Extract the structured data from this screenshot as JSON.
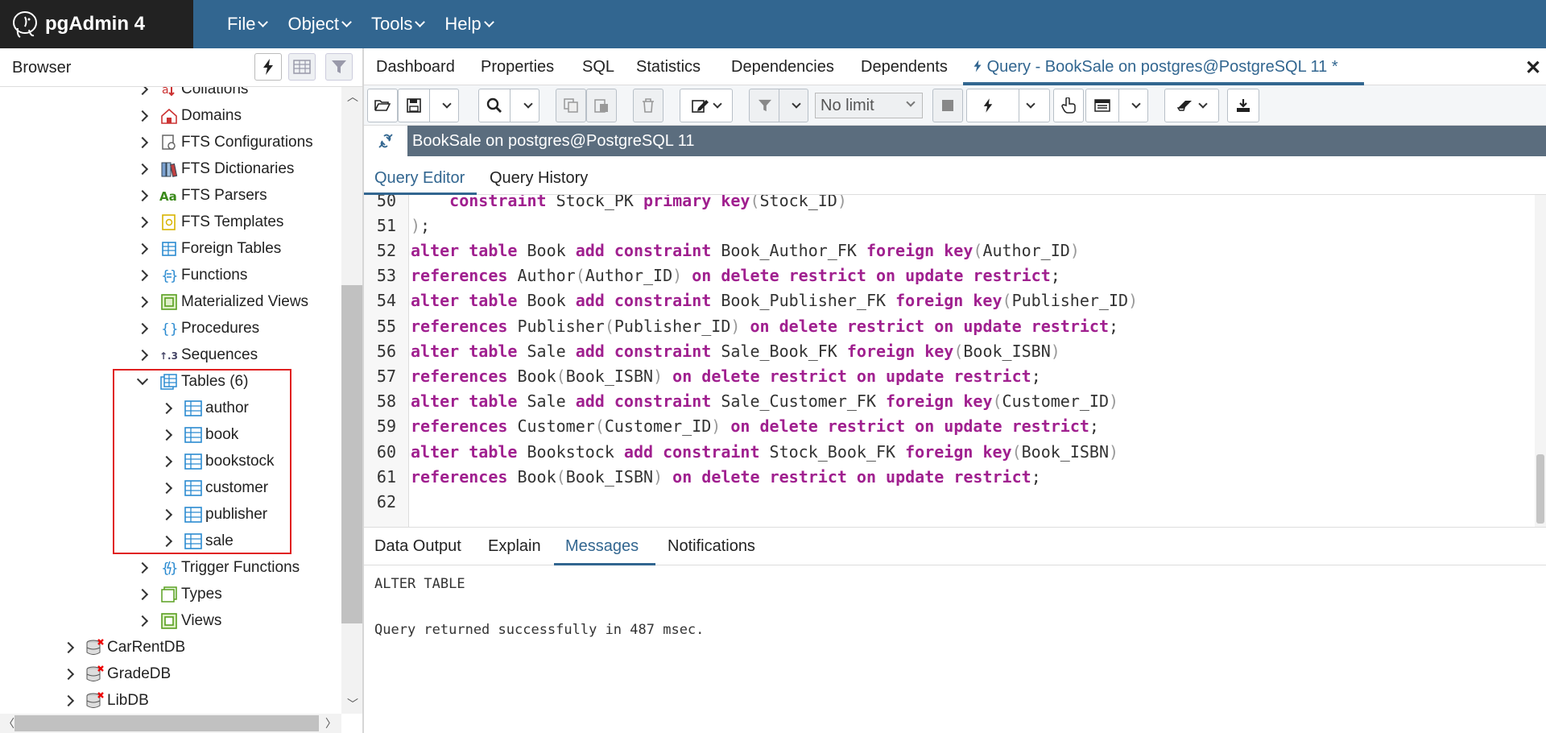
{
  "app": {
    "name": "pgAdmin 4",
    "menu": [
      "File",
      "Object",
      "Tools",
      "Help"
    ]
  },
  "browser": {
    "title": "Browser",
    "tree": [
      {
        "label": "Collations",
        "icon": "collation-icon",
        "level": 2,
        "expanded": false
      },
      {
        "label": "Domains",
        "icon": "domain-icon",
        "level": 2,
        "expanded": false
      },
      {
        "label": "FTS Configurations",
        "icon": "fts-configuration-icon",
        "level": 2,
        "expanded": false
      },
      {
        "label": "FTS Dictionaries",
        "icon": "fts-dictionary-icon",
        "level": 2,
        "expanded": false
      },
      {
        "label": "FTS Parsers",
        "icon": "fts-parser-icon",
        "level": 2,
        "expanded": false
      },
      {
        "label": "FTS Templates",
        "icon": "fts-template-icon",
        "level": 2,
        "expanded": false
      },
      {
        "label": "Foreign Tables",
        "icon": "foreign-table-icon",
        "level": 2,
        "expanded": false
      },
      {
        "label": "Functions",
        "icon": "function-icon",
        "level": 2,
        "expanded": false
      },
      {
        "label": "Materialized Views",
        "icon": "materialized-view-icon",
        "level": 2,
        "expanded": false
      },
      {
        "label": "Procedures",
        "icon": "procedure-icon",
        "level": 2,
        "expanded": false
      },
      {
        "label": "Sequences",
        "icon": "sequence-icon",
        "level": 2,
        "expanded": false
      },
      {
        "label": "Tables (6)",
        "icon": "tables-icon",
        "level": 2,
        "expanded": true
      },
      {
        "label": "author",
        "icon": "table-icon",
        "level": 3,
        "expanded": false
      },
      {
        "label": "book",
        "icon": "table-icon",
        "level": 3,
        "expanded": false
      },
      {
        "label": "bookstock",
        "icon": "table-icon",
        "level": 3,
        "expanded": false
      },
      {
        "label": "customer",
        "icon": "table-icon",
        "level": 3,
        "expanded": false
      },
      {
        "label": "publisher",
        "icon": "table-icon",
        "level": 3,
        "expanded": false
      },
      {
        "label": "sale",
        "icon": "table-icon",
        "level": 3,
        "expanded": false
      },
      {
        "label": "Trigger Functions",
        "icon": "trigger-function-icon",
        "level": 2,
        "expanded": false
      },
      {
        "label": "Types",
        "icon": "type-icon",
        "level": 2,
        "expanded": false
      },
      {
        "label": "Views",
        "icon": "view-icon",
        "level": 2,
        "expanded": false
      },
      {
        "label": "CarRentDB",
        "icon": "database-disconnected-icon",
        "level": 1,
        "expanded": false
      },
      {
        "label": "GradeDB",
        "icon": "database-disconnected-icon",
        "level": 1,
        "expanded": false
      },
      {
        "label": "LibDB",
        "icon": "database-disconnected-icon",
        "level": 1,
        "expanded": false
      }
    ]
  },
  "tabs": [
    "Dashboard",
    "Properties",
    "SQL",
    "Statistics",
    "Dependencies",
    "Dependents",
    "Query - BookSale on postgres@PostgreSQL 11 *"
  ],
  "active_tab": "Query - BookSale on postgres@PostgreSQL 11 *",
  "toolbar": {
    "limit": "No limit"
  },
  "connection": {
    "label": "BookSale on postgres@PostgreSQL 11"
  },
  "editor_tabs": [
    "Query Editor",
    "Query History"
  ],
  "code_lines": [
    {
      "n": "50",
      "tokens": [
        [
          "c",
          "    "
        ],
        [
          "k",
          "constraint"
        ],
        [
          "c",
          " Stock_PK "
        ],
        [
          "k",
          "primary key"
        ],
        [
          "p",
          "("
        ],
        [
          "c",
          "Stock_ID"
        ],
        [
          "p",
          ")"
        ]
      ]
    },
    {
      "n": "51",
      "tokens": [
        [
          "p",
          ")"
        ],
        [
          "c",
          ";"
        ]
      ]
    },
    {
      "n": "52",
      "tokens": [
        [
          "k",
          "alter table"
        ],
        [
          "c",
          " Book "
        ],
        [
          "k",
          "add constraint"
        ],
        [
          "c",
          " Book_Author_FK "
        ],
        [
          "k",
          "foreign key"
        ],
        [
          "p",
          "("
        ],
        [
          "c",
          "Author_ID"
        ],
        [
          "p",
          ")"
        ]
      ]
    },
    {
      "n": "53",
      "tokens": [
        [
          "k",
          "references"
        ],
        [
          "c",
          " Author"
        ],
        [
          "p",
          "("
        ],
        [
          "c",
          "Author_ID"
        ],
        [
          "p",
          ")"
        ],
        [
          "c",
          " "
        ],
        [
          "k",
          "on delete restrict on update restrict"
        ],
        [
          "c",
          ";"
        ]
      ]
    },
    {
      "n": "54",
      "tokens": [
        [
          "k",
          "alter table"
        ],
        [
          "c",
          " Book "
        ],
        [
          "k",
          "add constraint"
        ],
        [
          "c",
          " Book_Publisher_FK "
        ],
        [
          "k",
          "foreign key"
        ],
        [
          "p",
          "("
        ],
        [
          "c",
          "Publisher_ID"
        ],
        [
          "p",
          ")"
        ]
      ]
    },
    {
      "n": "55",
      "tokens": [
        [
          "k",
          "references"
        ],
        [
          "c",
          " Publisher"
        ],
        [
          "p",
          "("
        ],
        [
          "c",
          "Publisher_ID"
        ],
        [
          "p",
          ")"
        ],
        [
          "c",
          " "
        ],
        [
          "k",
          "on delete restrict on update restrict"
        ],
        [
          "c",
          ";"
        ]
      ]
    },
    {
      "n": "56",
      "tokens": [
        [
          "k",
          "alter table"
        ],
        [
          "c",
          " Sale "
        ],
        [
          "k",
          "add constraint"
        ],
        [
          "c",
          " Sale_Book_FK "
        ],
        [
          "k",
          "foreign key"
        ],
        [
          "p",
          "("
        ],
        [
          "c",
          "Book_ISBN"
        ],
        [
          "p",
          ")"
        ]
      ]
    },
    {
      "n": "57",
      "tokens": [
        [
          "k",
          "references"
        ],
        [
          "c",
          " Book"
        ],
        [
          "p",
          "("
        ],
        [
          "c",
          "Book_ISBN"
        ],
        [
          "p",
          ")"
        ],
        [
          "c",
          " "
        ],
        [
          "k",
          "on delete restrict on update restrict"
        ],
        [
          "c",
          ";"
        ]
      ]
    },
    {
      "n": "58",
      "tokens": [
        [
          "k",
          "alter table"
        ],
        [
          "c",
          " Sale "
        ],
        [
          "k",
          "add constraint"
        ],
        [
          "c",
          " Sale_Customer_FK "
        ],
        [
          "k",
          "foreign key"
        ],
        [
          "p",
          "("
        ],
        [
          "c",
          "Customer_ID"
        ],
        [
          "p",
          ")"
        ]
      ]
    },
    {
      "n": "59",
      "tokens": [
        [
          "k",
          "references"
        ],
        [
          "c",
          " Customer"
        ],
        [
          "p",
          "("
        ],
        [
          "c",
          "Customer_ID"
        ],
        [
          "p",
          ")"
        ],
        [
          "c",
          " "
        ],
        [
          "k",
          "on delete restrict on update restrict"
        ],
        [
          "c",
          ";"
        ]
      ]
    },
    {
      "n": "60",
      "tokens": [
        [
          "k",
          "alter table"
        ],
        [
          "c",
          " Bookstock "
        ],
        [
          "k",
          "add constraint"
        ],
        [
          "c",
          " Stock_Book_FK "
        ],
        [
          "k",
          "foreign key"
        ],
        [
          "p",
          "("
        ],
        [
          "c",
          "Book_ISBN"
        ],
        [
          "p",
          ")"
        ]
      ]
    },
    {
      "n": "61",
      "tokens": [
        [
          "k",
          "references"
        ],
        [
          "c",
          " Book"
        ],
        [
          "p",
          "("
        ],
        [
          "c",
          "Book_ISBN"
        ],
        [
          "p",
          ")"
        ],
        [
          "c",
          " "
        ],
        [
          "k",
          "on delete restrict on update restrict"
        ],
        [
          "c",
          ";"
        ]
      ]
    },
    {
      "n": "62",
      "tokens": []
    }
  ],
  "output_tabs": [
    "Data Output",
    "Explain",
    "Messages",
    "Notifications"
  ],
  "active_output_tab": "Messages",
  "messages": [
    "ALTER TABLE",
    "Query returned successfully in 487 msec."
  ],
  "colors": {
    "navbar": "#326690",
    "brand_bg": "#222222",
    "keyword": "#a0208f",
    "connection_bar": "#5b6d7e",
    "highlight_box": "#e02020"
  }
}
